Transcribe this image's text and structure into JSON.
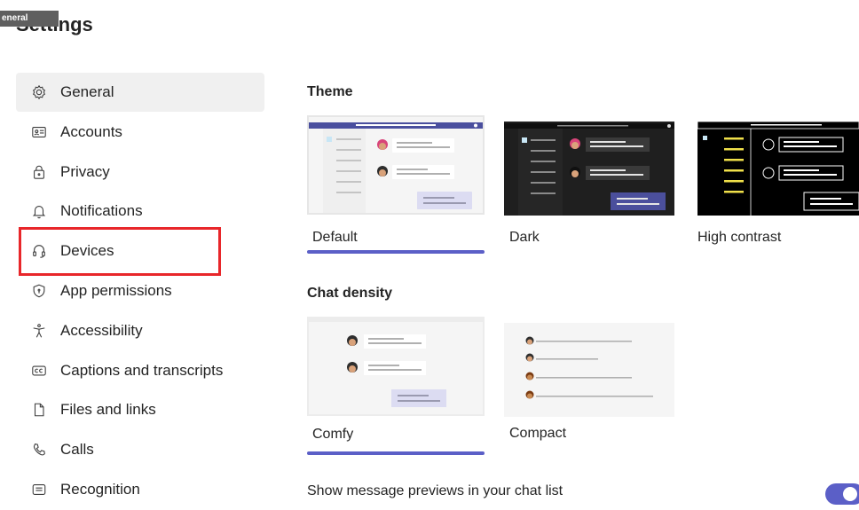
{
  "tooltip": "eneral",
  "title": "Settings",
  "sidebar": {
    "items": [
      {
        "label": "General",
        "icon": "gear-icon",
        "active": true
      },
      {
        "label": "Accounts",
        "icon": "id-card-icon"
      },
      {
        "label": "Privacy",
        "icon": "lock-icon"
      },
      {
        "label": "Notifications",
        "icon": "bell-icon"
      },
      {
        "label": "Devices",
        "icon": "headset-icon"
      },
      {
        "label": "App permissions",
        "icon": "shield-icon"
      },
      {
        "label": "Accessibility",
        "icon": "accessibility-icon"
      },
      {
        "label": "Captions and transcripts",
        "icon": "cc-icon"
      },
      {
        "label": "Files and links",
        "icon": "file-icon"
      },
      {
        "label": "Calls",
        "icon": "phone-icon"
      },
      {
        "label": "Recognition",
        "icon": "recognition-icon"
      }
    ]
  },
  "theme": {
    "heading": "Theme",
    "options": [
      {
        "label": "Default",
        "selected": true
      },
      {
        "label": "Dark",
        "selected": false
      },
      {
        "label": "High contrast",
        "selected": false
      }
    ]
  },
  "density": {
    "heading": "Chat density",
    "options": [
      {
        "label": "Comfy",
        "selected": true
      },
      {
        "label": "Compact",
        "selected": false
      }
    ]
  },
  "previews": {
    "label": "Show message previews in your chat list",
    "enabled": true
  },
  "colors": {
    "accent": "#5b5fc7",
    "highlight": "#e8262a"
  }
}
